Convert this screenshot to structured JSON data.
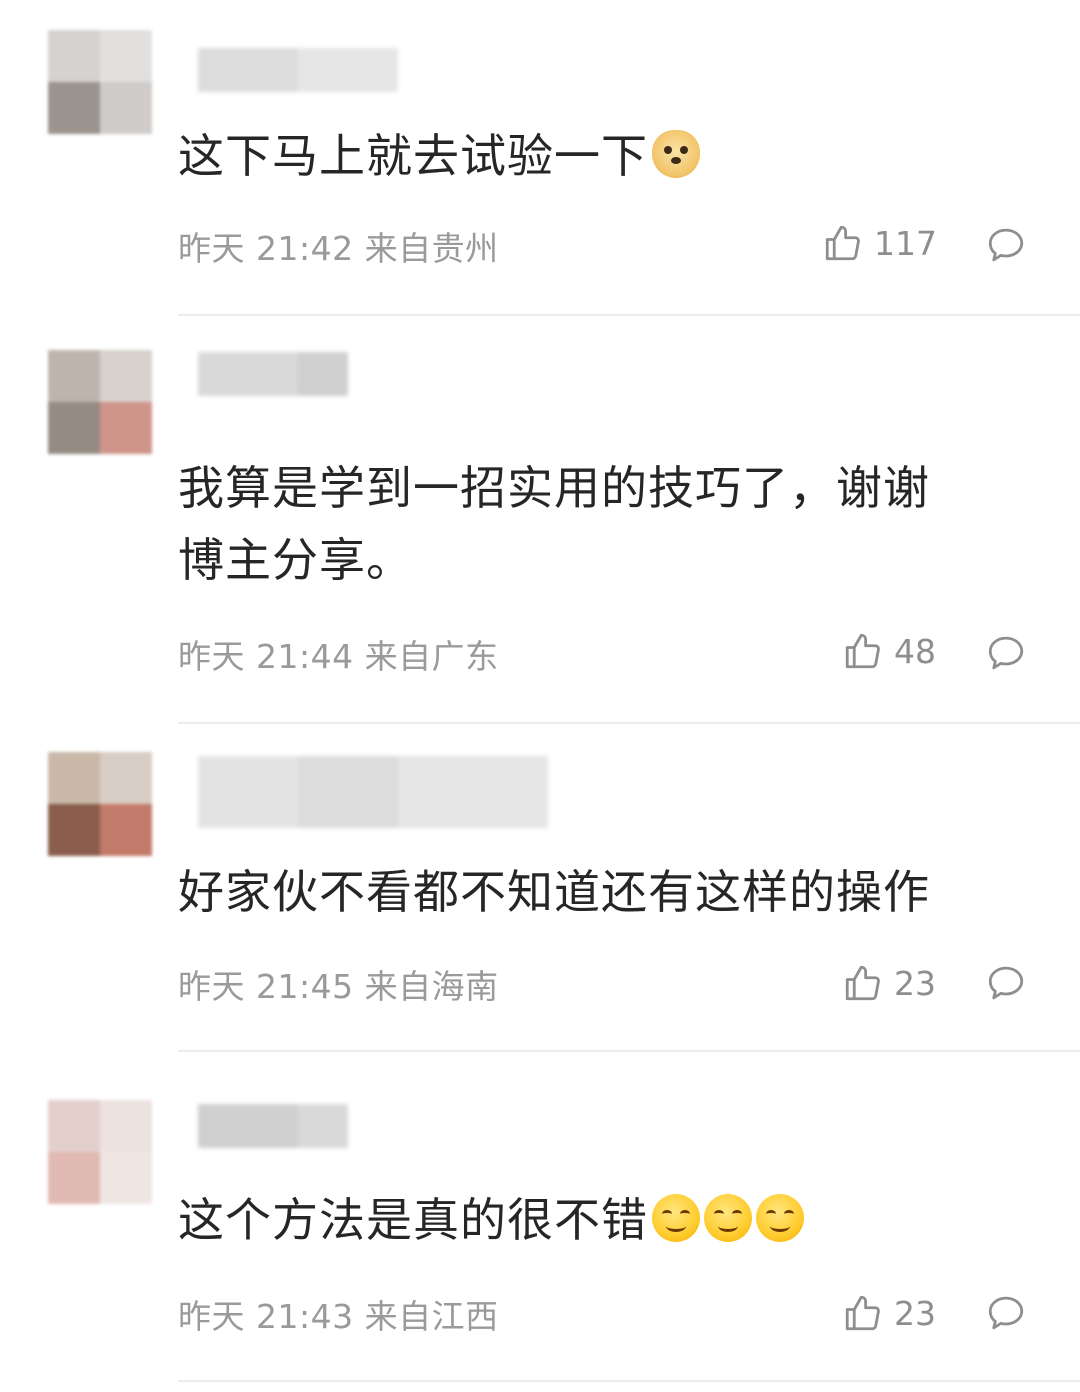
{
  "comments": [
    {
      "content": "这下马上就去试验一下",
      "emojis": [
        "doge-emoji"
      ],
      "time": "昨天 21:42",
      "location": "来自贵州",
      "likes": "117"
    },
    {
      "content_line1": "我算是学到一招实用的技巧了，谢谢",
      "content_line2": "博主分享。",
      "time": "昨天 21:44",
      "location": "来自广东",
      "likes": "48"
    },
    {
      "content": "好家伙不看都不知道还有这样的操作",
      "time": "昨天 21:45",
      "location": "来自海南",
      "likes": "23"
    },
    {
      "content": "这个方法是真的很不错",
      "emojis": [
        "smile-emoji",
        "smile-emoji",
        "smile-emoji"
      ],
      "time": "昨天 21:43",
      "location": "来自江西",
      "likes": "23"
    }
  ],
  "icons": {
    "like": "thumbs-up-icon",
    "reply": "speech-bubble-icon"
  },
  "colors": {
    "text": "#262626",
    "meta": "#9a9a9a",
    "divider": "#ececec"
  }
}
